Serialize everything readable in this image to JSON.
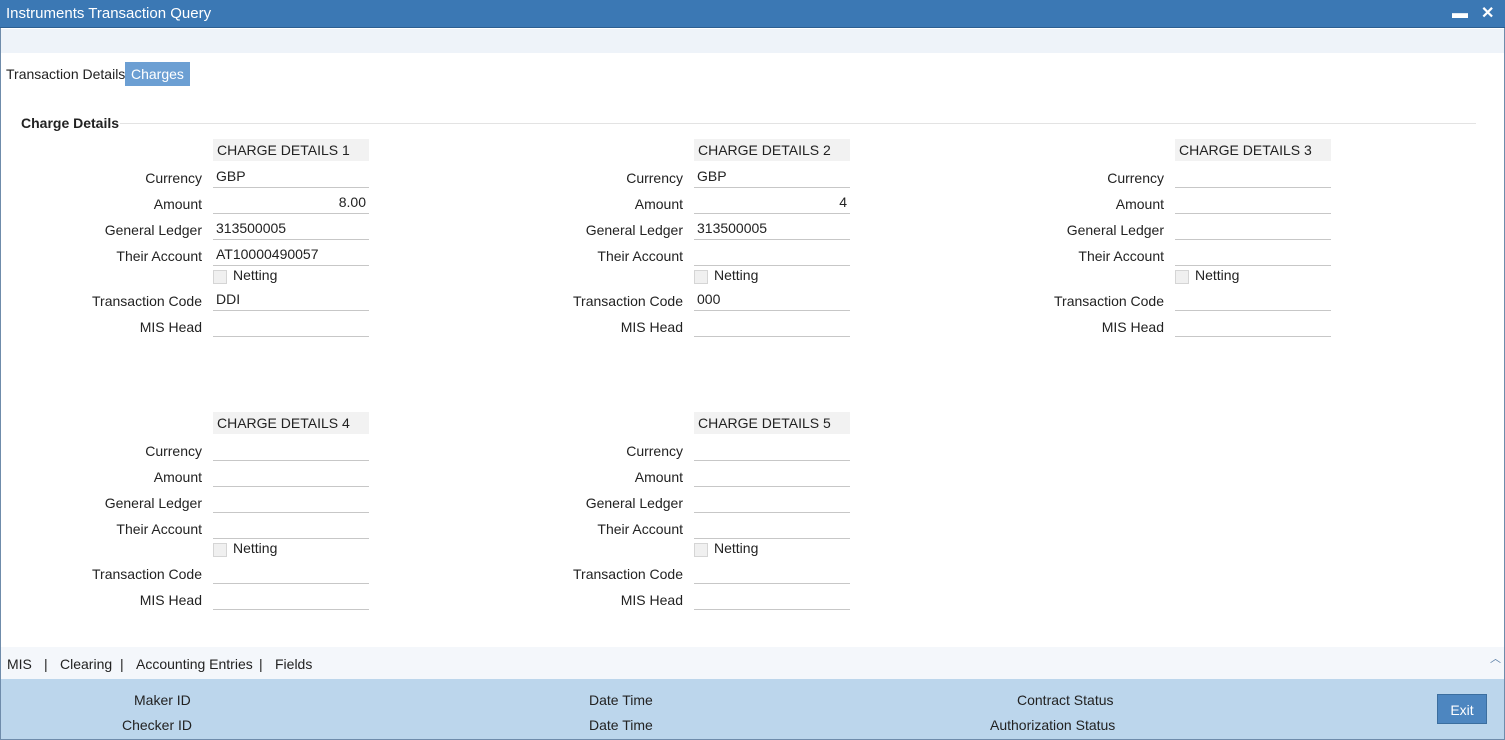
{
  "window": {
    "title": "Instruments Transaction Query",
    "minimize": "▬",
    "close": "✕"
  },
  "tabs": [
    "Transaction Details",
    "Charges"
  ],
  "section_title": "Charge Details",
  "labels": {
    "currency": "Currency",
    "amount": "Amount",
    "general_ledger": "General Ledger",
    "their_account": "Their Account",
    "netting": "Netting",
    "transaction_code": "Transaction Code",
    "mis_head": "MIS Head"
  },
  "groups": [
    {
      "title": "CHARGE DETAILS 1",
      "currency": "GBP",
      "amount": "8.00",
      "general_ledger": "313500005",
      "their_account": "AT10000490057",
      "transaction_code": "DDI",
      "mis_head": ""
    },
    {
      "title": "CHARGE DETAILS 2",
      "currency": "GBP",
      "amount": "4",
      "general_ledger": "313500005",
      "their_account": "",
      "transaction_code": "000",
      "mis_head": ""
    },
    {
      "title": "CHARGE DETAILS 3",
      "currency": "",
      "amount": "",
      "general_ledger": "",
      "their_account": "",
      "transaction_code": "",
      "mis_head": ""
    },
    {
      "title": "CHARGE DETAILS 4",
      "currency": "",
      "amount": "",
      "general_ledger": "",
      "their_account": "",
      "transaction_code": "",
      "mis_head": ""
    },
    {
      "title": "CHARGE DETAILS 5",
      "currency": "",
      "amount": "",
      "general_ledger": "",
      "their_account": "",
      "transaction_code": "",
      "mis_head": ""
    }
  ],
  "bottom_links": [
    "MIS",
    "Clearing",
    "Accounting Entries",
    "Fields"
  ],
  "bottom_sep": "|",
  "scroll_up": "︿",
  "footer": {
    "maker_id": "Maker ID",
    "checker_id": "Checker ID",
    "date_time": "Date Time",
    "contract_status": "Contract Status",
    "authorization_status": "Authorization Status",
    "exit": "Exit"
  }
}
